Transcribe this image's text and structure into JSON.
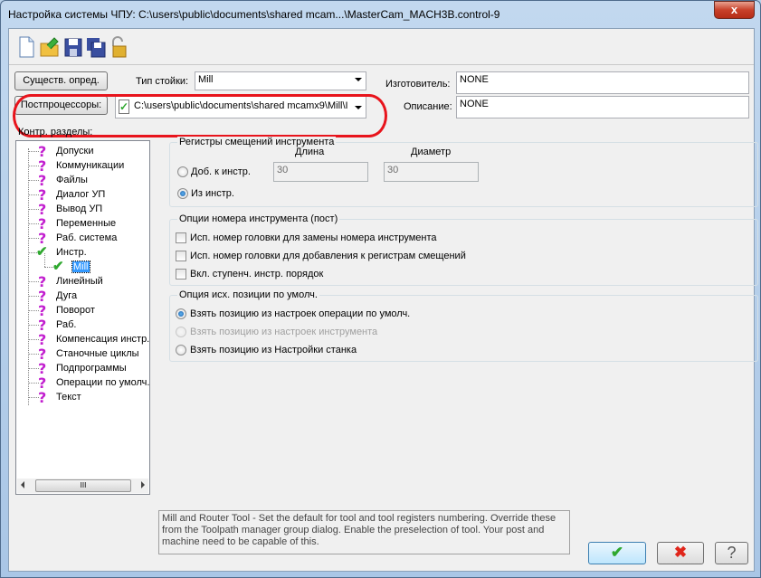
{
  "window": {
    "title": "Настройка системы ЧПУ: C:\\users\\public\\documents\\shared mcam...\\MasterCam_MACH3B.control-9",
    "close": "x"
  },
  "toolbar": {
    "icons": [
      "new-file-icon",
      "open-folder-icon",
      "save-icon",
      "save-as-icon",
      "unlock-icon"
    ]
  },
  "top": {
    "defaults_button": "Существ. опред.",
    "control_type_label": "Тип стойки:",
    "control_type_value": "Mill",
    "manufacturer_label": "Изготовитель:",
    "manufacturer_value": "NONE",
    "posts_button": "Постпроцессоры:",
    "post_path": "C:\\users\\public\\documents\\shared mcamx9\\Mill\\I",
    "description_label": "Описание:",
    "description_value": "NONE"
  },
  "tree": {
    "label": "Контр. разделы:",
    "items": [
      {
        "label": "Допуски",
        "status": "unknown"
      },
      {
        "label": "Коммуникации",
        "status": "unknown"
      },
      {
        "label": "Файлы",
        "status": "unknown"
      },
      {
        "label": "Диалог УП",
        "status": "unknown"
      },
      {
        "label": "Вывод УП",
        "status": "unknown"
      },
      {
        "label": "Переменные",
        "status": "unknown"
      },
      {
        "label": "Раб. система",
        "status": "unknown"
      },
      {
        "label": "Инстр.",
        "status": "ok"
      },
      {
        "label": "Mill",
        "status": "ok",
        "child": true,
        "selected": true
      },
      {
        "label": "Линейный",
        "status": "unknown"
      },
      {
        "label": "Дуга",
        "status": "unknown"
      },
      {
        "label": "Поворот",
        "status": "unknown"
      },
      {
        "label": "Раб.",
        "status": "unknown"
      },
      {
        "label": "Компенсация инстр.",
        "status": "unknown"
      },
      {
        "label": "Станочные циклы",
        "status": "unknown"
      },
      {
        "label": "Подпрограммы",
        "status": "unknown"
      },
      {
        "label": "Операции по умолч.",
        "status": "unknown"
      },
      {
        "label": "Текст",
        "status": "unknown"
      }
    ],
    "scroll_thumb": "III"
  },
  "offsets": {
    "title": "Регистры смещений инструмента",
    "length_label": "Длина",
    "diameter_label": "Диаметр",
    "add_to_tool": "Доб. к инстр.",
    "from_tool": "Из инстр.",
    "length_value": "30",
    "diameter_value": "30",
    "selected": "from_tool"
  },
  "tool_number": {
    "title": "Опции номера инструмента (пост)",
    "options": [
      {
        "label": "Исп. номер головки для замены номера инструмента",
        "checked": false
      },
      {
        "label": "Исп. номер головки для добавления к регистрам смещений",
        "checked": false
      },
      {
        "label": "Вкл. ступенч. инстр. порядок",
        "checked": false
      }
    ]
  },
  "home": {
    "title": "Опция исх. позиции по умолч.",
    "options": [
      {
        "label": "Взять позицию из настроек операции по умолч.",
        "selected": true,
        "disabled": false
      },
      {
        "label": "Взять позицию из настроек инструмента",
        "selected": false,
        "disabled": true
      },
      {
        "label": "Взять позицию из Настройки станка",
        "selected": false,
        "disabled": false
      }
    ]
  },
  "help_text": "Mill and Router Tool - Set the default for tool and tool registers numbering.  Override these from the Toolpath manager group dialog.  Enable the preselection of tool.  Your post and machine need to be capable of this.",
  "buttons": {
    "ok": "✔",
    "cancel": "✖",
    "help": "?"
  },
  "colors": {
    "highlight": "#e8141c",
    "question": "#c21fcf",
    "check": "#2fa82f"
  }
}
